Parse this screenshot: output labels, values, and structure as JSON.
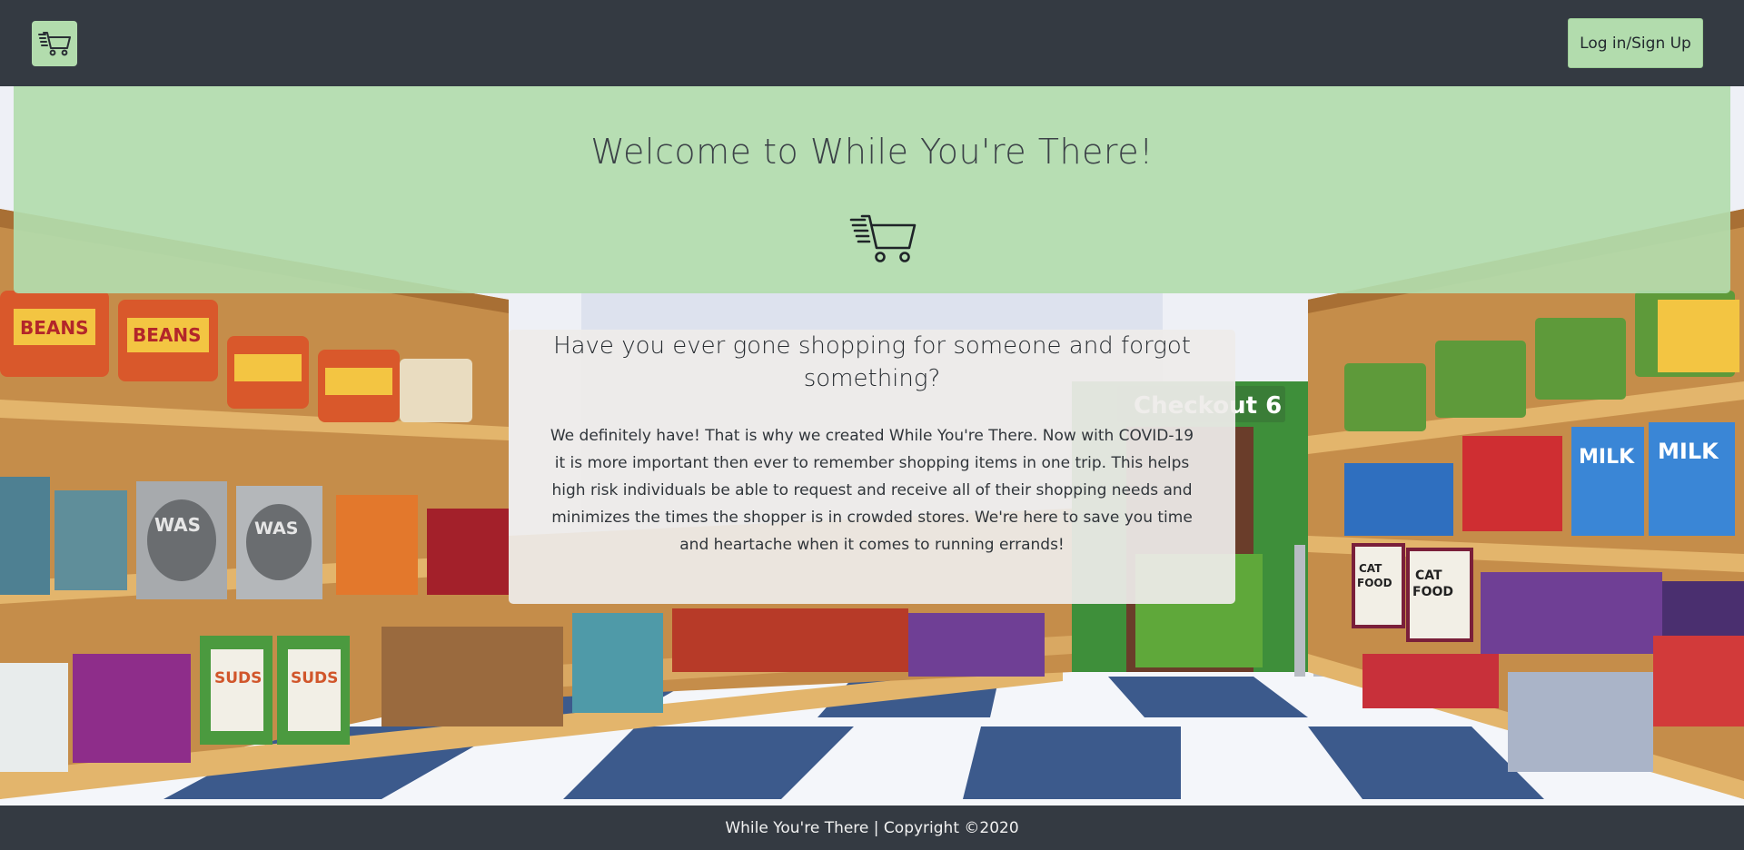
{
  "header": {
    "logo_icon": "shopping-cart-icon",
    "login_label": "Log in/Sign Up"
  },
  "hero": {
    "title": "Welcome to While You're There!",
    "icon": "shopping-cart-icon"
  },
  "card": {
    "heading": "Have you ever gone shopping for someone and forgot something?",
    "body": "We definitely have! That is why we created While You're There. Now with COVID-19 it is more important then ever to remember shopping items in one trip. This helps high risk individuals be able to request and receive all of their shopping needs and minimizes the times the shopper is in crowded stores. We're here to save you time and heartache when it comes to running errands!"
  },
  "background": {
    "signs": [
      "Checkout 6",
      "BEANS",
      "WAS",
      "SUDS",
      "MILK",
      "CAT FOOD"
    ]
  },
  "footer": {
    "text": "While You're There | Copyright ©2020"
  },
  "colors": {
    "navbar": "#343a42",
    "accent": "#b2dcad",
    "card": "#eeecea"
  }
}
